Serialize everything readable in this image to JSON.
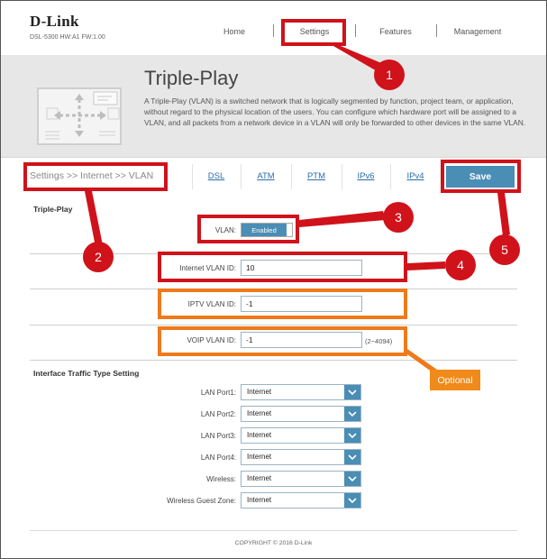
{
  "header": {
    "logo": "D-Link",
    "model": "DSL-5300 HW:A1 FW:1.00",
    "nav": [
      {
        "label": "Home"
      },
      {
        "label": "Settings"
      },
      {
        "label": "Features"
      },
      {
        "label": "Management"
      }
    ]
  },
  "banner": {
    "title": "Triple-Play",
    "description": "A Triple-Play (VLAN) is a switched network that is logically segmented by function, project team, or application, without regard to the physical location of the users. You can configure which hardware port will be assigned to a VLAN, and all packets from a network device in a VLAN will only be forwarded to other devices in the same VLAN."
  },
  "tabs": {
    "breadcrumb": "Settings >> Internet >> VLAN",
    "items": [
      {
        "label": "DSL"
      },
      {
        "label": "ATM"
      },
      {
        "label": "PTM"
      },
      {
        "label": "IPv6"
      },
      {
        "label": "IPv4"
      }
    ],
    "save_label": "Save"
  },
  "triple_play": {
    "title": "Triple-Play",
    "vlan_label": "VLAN:",
    "vlan_state": "Enabled",
    "internet_label": "Internet VLAN ID:",
    "internet_value": "10",
    "iptv_label": "IPTV VLAN ID:",
    "iptv_value": "-1",
    "voip_label": "VOIP VLAN ID:",
    "voip_value": "-1",
    "voip_hint": "(2~4094)"
  },
  "interface": {
    "title": "Interface Traffic Type Setting",
    "ports": [
      {
        "label": "LAN Port1:",
        "value": "Internet"
      },
      {
        "label": "LAN Port2:",
        "value": "Internet"
      },
      {
        "label": "LAN Port3:",
        "value": "Internet"
      },
      {
        "label": "LAN Port4:",
        "value": "Internet"
      },
      {
        "label": "Wireless:",
        "value": "Internet"
      },
      {
        "label": "Wireless Guest Zone:",
        "value": "Internet"
      }
    ]
  },
  "footer": {
    "copyright": "COPYRIGHT © 2016 D-Link"
  },
  "annotations": {
    "markers": [
      "1",
      "2",
      "3",
      "4",
      "5"
    ],
    "optional": "Optional",
    "colors": {
      "red": "#d0121b",
      "orange": "#ef7a1a",
      "button": "#4a8db5"
    }
  }
}
